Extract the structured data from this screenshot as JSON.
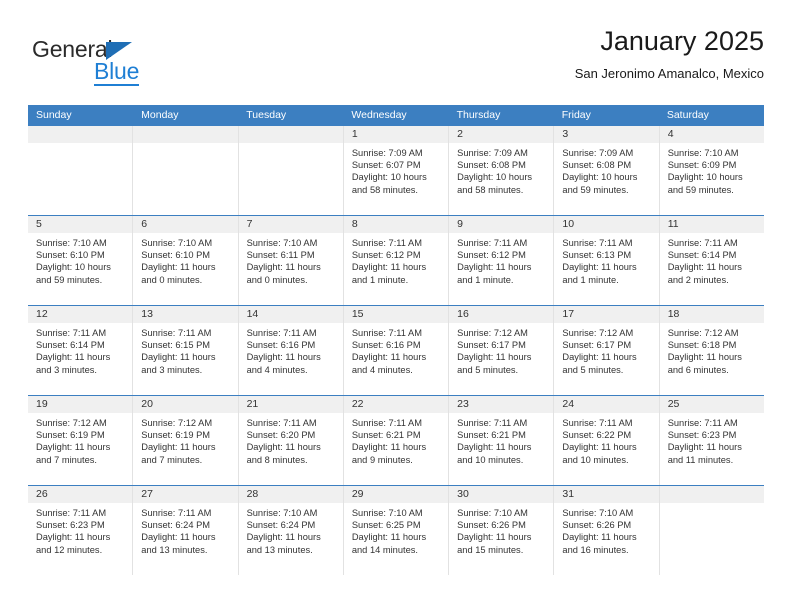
{
  "brand": {
    "name_top": "General",
    "name_bottom": "Blue",
    "accent_color": "#1f7fd4"
  },
  "header": {
    "title": "January 2025",
    "subtitle": "San Jeronimo Amanalco, Mexico"
  },
  "calendar": {
    "header_color": "#3c7fc1",
    "weekdays": [
      "Sunday",
      "Monday",
      "Tuesday",
      "Wednesday",
      "Thursday",
      "Friday",
      "Saturday"
    ],
    "weeks": [
      [
        {
          "day": "",
          "empty": true
        },
        {
          "day": "",
          "empty": true
        },
        {
          "day": "",
          "empty": true
        },
        {
          "day": "1",
          "sunrise": "Sunrise: 7:09 AM",
          "sunset": "Sunset: 6:07 PM",
          "daylight1": "Daylight: 10 hours",
          "daylight2": "and 58 minutes."
        },
        {
          "day": "2",
          "sunrise": "Sunrise: 7:09 AM",
          "sunset": "Sunset: 6:08 PM",
          "daylight1": "Daylight: 10 hours",
          "daylight2": "and 58 minutes."
        },
        {
          "day": "3",
          "sunrise": "Sunrise: 7:09 AM",
          "sunset": "Sunset: 6:08 PM",
          "daylight1": "Daylight: 10 hours",
          "daylight2": "and 59 minutes."
        },
        {
          "day": "4",
          "sunrise": "Sunrise: 7:10 AM",
          "sunset": "Sunset: 6:09 PM",
          "daylight1": "Daylight: 10 hours",
          "daylight2": "and 59 minutes."
        }
      ],
      [
        {
          "day": "5",
          "sunrise": "Sunrise: 7:10 AM",
          "sunset": "Sunset: 6:10 PM",
          "daylight1": "Daylight: 10 hours",
          "daylight2": "and 59 minutes."
        },
        {
          "day": "6",
          "sunrise": "Sunrise: 7:10 AM",
          "sunset": "Sunset: 6:10 PM",
          "daylight1": "Daylight: 11 hours",
          "daylight2": "and 0 minutes."
        },
        {
          "day": "7",
          "sunrise": "Sunrise: 7:10 AM",
          "sunset": "Sunset: 6:11 PM",
          "daylight1": "Daylight: 11 hours",
          "daylight2": "and 0 minutes."
        },
        {
          "day": "8",
          "sunrise": "Sunrise: 7:11 AM",
          "sunset": "Sunset: 6:12 PM",
          "daylight1": "Daylight: 11 hours",
          "daylight2": "and 1 minute."
        },
        {
          "day": "9",
          "sunrise": "Sunrise: 7:11 AM",
          "sunset": "Sunset: 6:12 PM",
          "daylight1": "Daylight: 11 hours",
          "daylight2": "and 1 minute."
        },
        {
          "day": "10",
          "sunrise": "Sunrise: 7:11 AM",
          "sunset": "Sunset: 6:13 PM",
          "daylight1": "Daylight: 11 hours",
          "daylight2": "and 1 minute."
        },
        {
          "day": "11",
          "sunrise": "Sunrise: 7:11 AM",
          "sunset": "Sunset: 6:14 PM",
          "daylight1": "Daylight: 11 hours",
          "daylight2": "and 2 minutes."
        }
      ],
      [
        {
          "day": "12",
          "sunrise": "Sunrise: 7:11 AM",
          "sunset": "Sunset: 6:14 PM",
          "daylight1": "Daylight: 11 hours",
          "daylight2": "and 3 minutes."
        },
        {
          "day": "13",
          "sunrise": "Sunrise: 7:11 AM",
          "sunset": "Sunset: 6:15 PM",
          "daylight1": "Daylight: 11 hours",
          "daylight2": "and 3 minutes."
        },
        {
          "day": "14",
          "sunrise": "Sunrise: 7:11 AM",
          "sunset": "Sunset: 6:16 PM",
          "daylight1": "Daylight: 11 hours",
          "daylight2": "and 4 minutes."
        },
        {
          "day": "15",
          "sunrise": "Sunrise: 7:11 AM",
          "sunset": "Sunset: 6:16 PM",
          "daylight1": "Daylight: 11 hours",
          "daylight2": "and 4 minutes."
        },
        {
          "day": "16",
          "sunrise": "Sunrise: 7:12 AM",
          "sunset": "Sunset: 6:17 PM",
          "daylight1": "Daylight: 11 hours",
          "daylight2": "and 5 minutes."
        },
        {
          "day": "17",
          "sunrise": "Sunrise: 7:12 AM",
          "sunset": "Sunset: 6:17 PM",
          "daylight1": "Daylight: 11 hours",
          "daylight2": "and 5 minutes."
        },
        {
          "day": "18",
          "sunrise": "Sunrise: 7:12 AM",
          "sunset": "Sunset: 6:18 PM",
          "daylight1": "Daylight: 11 hours",
          "daylight2": "and 6 minutes."
        }
      ],
      [
        {
          "day": "19",
          "sunrise": "Sunrise: 7:12 AM",
          "sunset": "Sunset: 6:19 PM",
          "daylight1": "Daylight: 11 hours",
          "daylight2": "and 7 minutes."
        },
        {
          "day": "20",
          "sunrise": "Sunrise: 7:12 AM",
          "sunset": "Sunset: 6:19 PM",
          "daylight1": "Daylight: 11 hours",
          "daylight2": "and 7 minutes."
        },
        {
          "day": "21",
          "sunrise": "Sunrise: 7:11 AM",
          "sunset": "Sunset: 6:20 PM",
          "daylight1": "Daylight: 11 hours",
          "daylight2": "and 8 minutes."
        },
        {
          "day": "22",
          "sunrise": "Sunrise: 7:11 AM",
          "sunset": "Sunset: 6:21 PM",
          "daylight1": "Daylight: 11 hours",
          "daylight2": "and 9 minutes."
        },
        {
          "day": "23",
          "sunrise": "Sunrise: 7:11 AM",
          "sunset": "Sunset: 6:21 PM",
          "daylight1": "Daylight: 11 hours",
          "daylight2": "and 10 minutes."
        },
        {
          "day": "24",
          "sunrise": "Sunrise: 7:11 AM",
          "sunset": "Sunset: 6:22 PM",
          "daylight1": "Daylight: 11 hours",
          "daylight2": "and 10 minutes."
        },
        {
          "day": "25",
          "sunrise": "Sunrise: 7:11 AM",
          "sunset": "Sunset: 6:23 PM",
          "daylight1": "Daylight: 11 hours",
          "daylight2": "and 11 minutes."
        }
      ],
      [
        {
          "day": "26",
          "sunrise": "Sunrise: 7:11 AM",
          "sunset": "Sunset: 6:23 PM",
          "daylight1": "Daylight: 11 hours",
          "daylight2": "and 12 minutes."
        },
        {
          "day": "27",
          "sunrise": "Sunrise: 7:11 AM",
          "sunset": "Sunset: 6:24 PM",
          "daylight1": "Daylight: 11 hours",
          "daylight2": "and 13 minutes."
        },
        {
          "day": "28",
          "sunrise": "Sunrise: 7:10 AM",
          "sunset": "Sunset: 6:24 PM",
          "daylight1": "Daylight: 11 hours",
          "daylight2": "and 13 minutes."
        },
        {
          "day": "29",
          "sunrise": "Sunrise: 7:10 AM",
          "sunset": "Sunset: 6:25 PM",
          "daylight1": "Daylight: 11 hours",
          "daylight2": "and 14 minutes."
        },
        {
          "day": "30",
          "sunrise": "Sunrise: 7:10 AM",
          "sunset": "Sunset: 6:26 PM",
          "daylight1": "Daylight: 11 hours",
          "daylight2": "and 15 minutes."
        },
        {
          "day": "31",
          "sunrise": "Sunrise: 7:10 AM",
          "sunset": "Sunset: 6:26 PM",
          "daylight1": "Daylight: 11 hours",
          "daylight2": "and 16 minutes."
        },
        {
          "day": "",
          "empty": true
        }
      ]
    ]
  }
}
